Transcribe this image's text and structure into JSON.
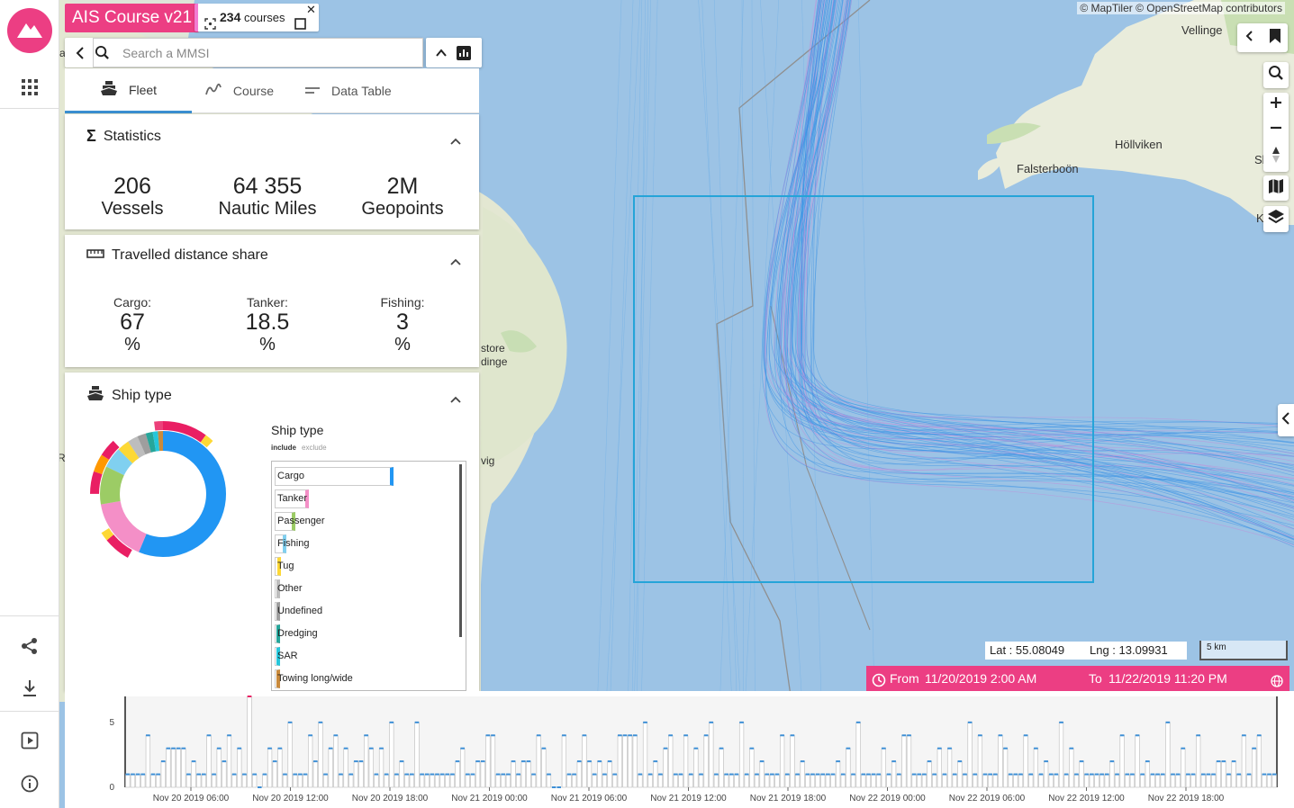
{
  "app": {
    "title": "AIS Course v21"
  },
  "course_chip": {
    "count": "234",
    "label": "courses"
  },
  "search": {
    "placeholder": "Search a MMSI"
  },
  "tabs": [
    {
      "label": "Fleet",
      "icon": "ship-icon",
      "active": true
    },
    {
      "label": "Course",
      "icon": "route-icon",
      "active": false
    },
    {
      "label": "Data Table",
      "icon": "table-icon",
      "active": false
    }
  ],
  "statistics": {
    "title": "Statistics",
    "items": [
      {
        "value": "206",
        "label": "Vessels"
      },
      {
        "value": "64 355",
        "label": "Nautic Miles"
      },
      {
        "value": "2M",
        "label": "Geopoints"
      }
    ]
  },
  "distance_share": {
    "title": "Travelled distance share",
    "items": [
      {
        "label": "Cargo:",
        "value": "67",
        "unit": "%"
      },
      {
        "label": "Tanker:",
        "value": "18.5",
        "unit": "%"
      },
      {
        "label": "Fishing:",
        "value": "3",
        "unit": "%"
      }
    ]
  },
  "ship_type": {
    "title": "Ship type",
    "list_title": "Ship type",
    "include_label": "include",
    "exclude_label": "exclude",
    "items": [
      {
        "label": "Cargo",
        "share": 0.63,
        "color": "#2196f3"
      },
      {
        "label": "Tanker",
        "share": 0.18,
        "color": "#f48fc7"
      },
      {
        "label": "Passenger",
        "share": 0.11,
        "color": "#9ccc65"
      },
      {
        "label": "Fishing",
        "share": 0.06,
        "color": "#80d0f0"
      },
      {
        "label": "Tug",
        "share": 0.035,
        "color": "#fdd835"
      },
      {
        "label": "Other",
        "share": 0.03,
        "color": "#bdbdbd"
      },
      {
        "label": "Undefined",
        "share": 0.025,
        "color": "#9e9e9e"
      },
      {
        "label": "Dredging",
        "share": 0.02,
        "color": "#26a69a"
      },
      {
        "label": "SAR",
        "share": 0.015,
        "color": "#26c6da"
      },
      {
        "label": "Towing long/wide",
        "share": 0.015,
        "color": "#c98a3c"
      }
    ]
  },
  "map": {
    "attribution": "© MapTiler © OpenStreetMap contributors",
    "places": [
      "Vellinge",
      "Höllviken",
      "Falsterboön",
      "Sk",
      "K",
      "store",
      "dinge",
      "vig",
      "Ro",
      "a"
    ],
    "lat": "Lat : 55.08049",
    "lng": "Lng : 13.09931",
    "scale": "5 km",
    "range_from_label": "From",
    "range_from": "11/20/2019 2:00 AM",
    "range_to_label": "To",
    "range_to": "11/22/2019 11:20 PM"
  },
  "timeline": {
    "y_ticks": [
      "0",
      "5"
    ],
    "x_ticks": [
      "Nov 20 2019 06:00",
      "Nov 20 2019 12:00",
      "Nov 20 2019 18:00",
      "Nov 21 2019 00:00",
      "Nov 21 2019 06:00",
      "Nov 21 2019 12:00",
      "Nov 21 2019 18:00",
      "Nov 22 2019 00:00",
      "Nov 22 2019 06:00",
      "Nov 22 2019 12:00",
      "Nov 22 2019 18:00"
    ]
  },
  "chart_data": {
    "type": "bar",
    "xlabel": "",
    "ylabel": "",
    "ylim": [
      0,
      7
    ],
    "values": [
      1,
      1,
      1,
      1,
      4,
      1,
      1,
      2,
      3,
      3,
      3,
      3,
      1,
      2,
      1,
      1,
      4,
      1,
      3,
      2,
      4,
      1,
      3,
      1,
      7,
      1,
      0,
      1,
      3,
      2,
      3,
      1,
      5,
      1,
      1,
      1,
      4,
      2,
      5,
      1,
      3,
      4,
      1,
      3,
      1,
      2,
      2,
      4,
      3,
      1,
      3,
      1,
      5,
      1,
      2,
      1,
      1,
      5,
      1,
      1,
      1,
      1,
      1,
      1,
      1,
      2,
      3,
      1,
      1,
      2,
      2,
      4,
      4,
      1,
      1,
      1,
      2,
      1,
      2,
      2,
      1,
      4,
      3,
      1,
      0,
      0,
      4,
      1,
      1,
      2,
      4,
      2,
      1,
      2,
      1,
      2,
      1,
      4,
      4,
      4,
      4,
      1,
      5,
      1,
      2,
      1,
      3,
      4,
      1,
      1,
      4,
      1,
      3,
      1,
      4,
      5,
      1,
      3,
      1,
      1,
      1,
      5,
      1,
      3,
      1,
      2,
      1,
      1,
      1,
      4,
      1,
      4,
      1,
      2,
      1,
      1,
      1,
      1,
      1,
      1,
      2,
      1,
      3,
      1,
      5,
      1,
      1,
      1,
      1,
      3,
      1,
      2,
      1,
      4,
      4,
      1,
      1,
      1,
      2,
      1,
      3,
      1,
      3,
      1,
      2,
      1,
      5,
      1,
      4,
      1,
      1,
      1,
      4,
      3,
      1,
      1,
      1,
      4,
      1,
      3,
      1,
      2,
      1,
      1,
      5,
      1,
      3,
      1,
      2,
      1,
      1,
      1,
      1,
      1,
      2,
      1,
      4,
      1,
      1,
      4,
      1,
      2,
      1,
      1,
      1,
      5,
      1,
      1,
      3,
      1,
      1,
      4,
      1,
      1,
      1,
      2,
      2,
      1,
      2,
      1,
      4,
      1,
      3,
      4,
      1,
      1,
      1
    ],
    "highlight_index": 24
  }
}
